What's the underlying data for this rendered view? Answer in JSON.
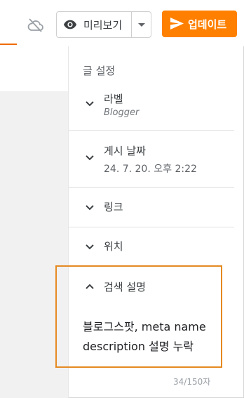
{
  "toolbar": {
    "sync_icon": "cloud-off-icon",
    "preview_label": "미리보기",
    "update_label": "업데이트",
    "accent_color": "#ff8000"
  },
  "panel": {
    "title": "글 설정",
    "sections": [
      {
        "label": "라벨",
        "value": "Blogger",
        "expanded": false
      },
      {
        "label": "게시 날짜",
        "value": "24. 7. 20. 오후 2:22",
        "expanded": false
      },
      {
        "label": "링크",
        "expanded": false
      },
      {
        "label": "위치",
        "expanded": false
      },
      {
        "label": "검색 설명",
        "expanded": true
      }
    ],
    "search_description": {
      "text": "블로그스팟, meta name description 설명 누락",
      "counter": "34/150자"
    }
  }
}
